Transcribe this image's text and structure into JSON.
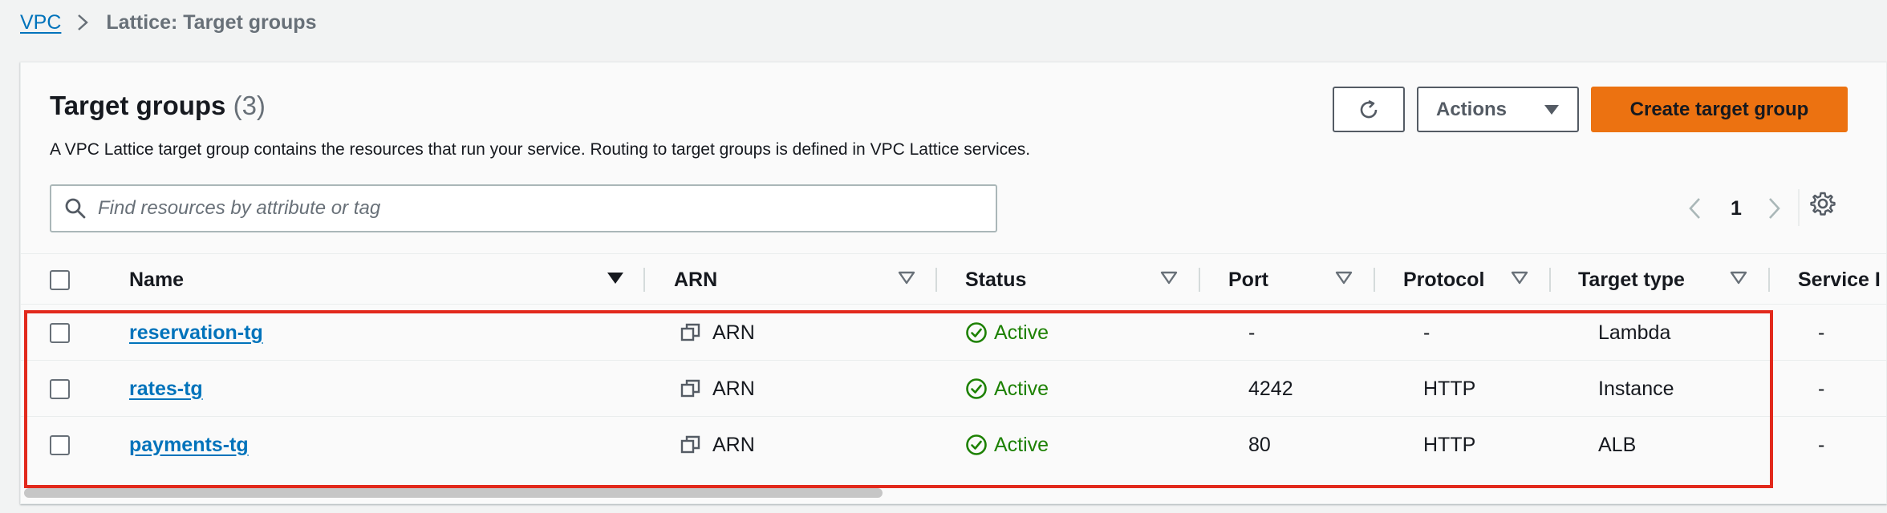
{
  "breadcrumb": {
    "root": "VPC",
    "current": "Lattice: Target groups"
  },
  "header": {
    "title": "Target groups",
    "count": "(3)",
    "description": "A VPC Lattice target group contains the resources that run your service. Routing to target groups is defined in VPC Lattice services."
  },
  "toolbar": {
    "actions_label": "Actions",
    "create_label": "Create target group"
  },
  "search": {
    "placeholder": "Find resources by attribute or tag"
  },
  "pagination": {
    "current_page": "1"
  },
  "table": {
    "columns": [
      "Name",
      "ARN",
      "Status",
      "Port",
      "Protocol",
      "Target type",
      "Service I"
    ],
    "rows": [
      {
        "name": "reservation-tg",
        "arn": "ARN",
        "status": "Active",
        "port": "-",
        "protocol": "-",
        "target_type": "Lambda",
        "service": "-"
      },
      {
        "name": "rates-tg",
        "arn": "ARN",
        "status": "Active",
        "port": "4242",
        "protocol": "HTTP",
        "target_type": "Instance",
        "service": "-"
      },
      {
        "name": "payments-tg",
        "arn": "ARN",
        "status": "Active",
        "port": "80",
        "protocol": "HTTP",
        "target_type": "ALB",
        "service": "-"
      }
    ]
  },
  "colors": {
    "link": "#0073bb",
    "primary_button": "#ec7211",
    "status_active": "#1d8102",
    "highlight_border": "#e2291c"
  },
  "icons": {
    "refresh": "refresh-icon",
    "dropdown": "caret-down-icon",
    "search": "search-icon",
    "settings": "gear-icon",
    "copy": "copy-icon",
    "status": "check-circle-icon"
  }
}
